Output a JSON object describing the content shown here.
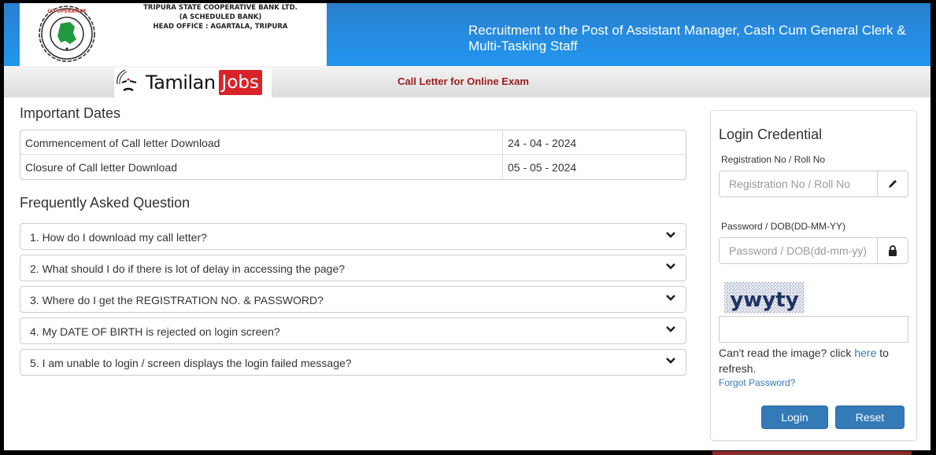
{
  "header": {
    "bank_name": "TRIPURA STATE COOPERATIVE BANK LTD.",
    "bank_subtitle": "(A SCHEDULED BANK)",
    "bank_head_office": "HEAD OFFICE : AGARTALA, TRIPURA",
    "seal_text": "TRIPURA STATE CO-OPERATIVE BANK LTD.",
    "title": "Recruitment to the Post of Assistant Manager, Cash Cum General Clerk & Multi-Tasking Staff",
    "colors": {
      "header_blue": "#2196ef",
      "seal_green": "#1f9a3c"
    }
  },
  "subbar": {
    "brand_name": "Tamilan",
    "brand_highlight": "Jobs",
    "page_title": "Call Letter for Online Exam",
    "colors": {
      "brand_red": "#d8232a",
      "title_red": "#9b1c1c"
    }
  },
  "important_dates": {
    "heading": "Important Dates",
    "rows": [
      {
        "label": "Commencement of Call letter Download",
        "value": "24 - 04 - 2024"
      },
      {
        "label": "Closure of Call letter Download",
        "value": "05 - 05 - 2024"
      }
    ]
  },
  "faq": {
    "heading": "Frequently Asked Question",
    "items": [
      {
        "question": "1. How do I download my call letter?",
        "icon": "chevron-down-icon"
      },
      {
        "question": "2. What should I do if there is lot of delay in accessing the page?",
        "icon": "chevron-down-icon"
      },
      {
        "question": "3. Where do I get the REGISTRATION NO. & PASSWORD?",
        "icon": "chevron-down-icon"
      },
      {
        "question": "4. My DATE OF BIRTH is rejected on login screen?",
        "icon": "chevron-down-icon"
      },
      {
        "question": "5. I am unable to login / screen displays the login failed message?",
        "icon": "chevron-down-icon"
      }
    ]
  },
  "login": {
    "title": "Login Credential",
    "registration": {
      "label": "Registration No / Roll No",
      "placeholder": "Registration No / Roll No",
      "value": "",
      "icon": "pencil-icon"
    },
    "password": {
      "label": "Password / DOB(DD-MM-YY)",
      "placeholder": "Password / DOB(dd-mm-yy)",
      "value": "",
      "icon": "lock-icon"
    },
    "captcha": {
      "text": "ywyty",
      "input_value": "",
      "refresh_prefix": "Can't read the image? click ",
      "refresh_link": "here",
      "refresh_suffix": " to refresh."
    },
    "forgot_password": "Forgot Password?",
    "login_button": "Login",
    "reset_button": "Reset",
    "colors": {
      "button_blue": "#337ab7",
      "link_blue": "#337ab7"
    }
  }
}
